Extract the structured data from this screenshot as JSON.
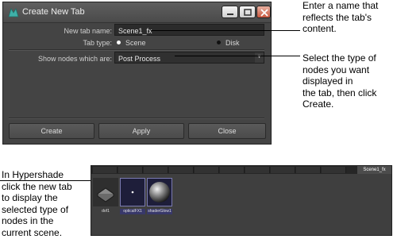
{
  "dialog": {
    "title": "Create New Tab",
    "tab_name_label": "New tab name:",
    "tab_name_value": "Scene1_fx",
    "tab_type_label": "Tab type:",
    "tab_type_options": [
      "Scene",
      "Disk"
    ],
    "tab_type_selected": "Scene",
    "show_nodes_label": "Show nodes which are:",
    "show_nodes_value": "Post Process",
    "buttons": {
      "create": "Create",
      "apply": "Apply",
      "close": "Close"
    }
  },
  "annotations": {
    "name": [
      "Enter a name that",
      "reflects the tab's",
      "content."
    ],
    "select": [
      "Select the type of",
      "nodes you want",
      "displayed in",
      "the tab, then click",
      "Create."
    ],
    "hypershade": [
      "In Hypershade",
      "click the new tab",
      "to display the",
      "selected type of",
      "nodes in the",
      "current scene."
    ]
  },
  "hypershade": {
    "active_tab": "Scene1_fx",
    "nodes": [
      "dof1",
      "opticalFX1",
      "shaderGlow1"
    ]
  },
  "colors": {
    "panel": "#444444",
    "field": "#2b2b2b",
    "selected_radio": "#ffffff",
    "unselected_radio": "#111111",
    "node_selected": "#38386a"
  }
}
